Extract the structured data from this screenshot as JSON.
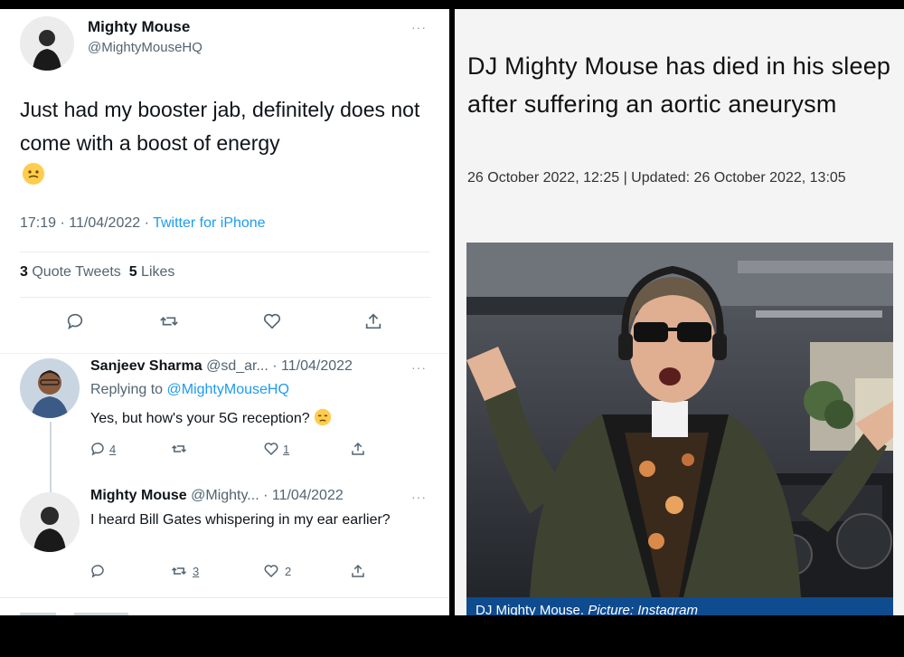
{
  "tweet": {
    "author_name": "Mighty Mouse",
    "author_handle": "@MightyMouseHQ",
    "more": "···",
    "text": "Just had my booster jab, definitely does not come with a boost of energy",
    "timestamp": "17:19 · 11/04/2022 · ",
    "source": "Twitter for iPhone",
    "quote_tweets_count": "3",
    "quote_tweets_label": "Quote Tweets",
    "likes_count": "5",
    "likes_label": "Likes"
  },
  "replies": [
    {
      "author_name": "Sanjeev Sharma",
      "meta": "@sd_ar... · 11/04/2022",
      "more": "···",
      "replying_prefix": "Replying to ",
      "replying_handle": "@MightyMouseHQ",
      "text": "Yes, but how's your 5G reception?",
      "reply_count": "4",
      "retweet_count": "",
      "like_count": "1"
    },
    {
      "author_name": "Mighty Mouse",
      "meta": "@Mighty... · 11/04/2022",
      "more": "···",
      "text": "I heard Bill Gates whispering in my ear earlier?",
      "reply_count": "",
      "retweet_count": "3",
      "like_count": "2"
    }
  ],
  "article": {
    "headline": "DJ Mighty Mouse has died in his sleep after suffering an aortic aneurysm",
    "dateline": "26 October 2022, 12:25 | Updated: 26 October 2022, 13:05",
    "caption_name": "DJ Mighty Mouse.",
    "caption_credit": "Picture: Instagram"
  },
  "colors": {
    "link_blue": "#1d9bf0",
    "muted_text": "#536471",
    "caption_bar": "#0e4b8f"
  },
  "icons": [
    "reply-icon",
    "retweet-icon",
    "like-icon",
    "share-icon",
    "more-icon"
  ]
}
